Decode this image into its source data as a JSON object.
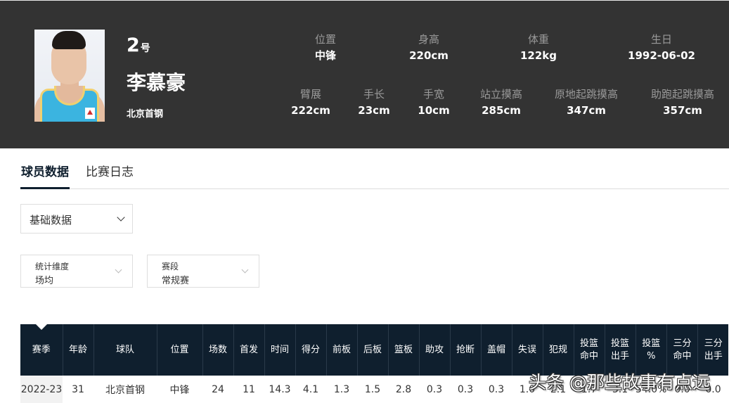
{
  "player": {
    "number": "2",
    "number_suffix": "号",
    "name": "李慕豪",
    "team": "北京首钢"
  },
  "attributes_row1": [
    {
      "label": "位置",
      "value": "中锋"
    },
    {
      "label": "身高",
      "value": "220cm"
    },
    {
      "label": "体重",
      "value": "122kg"
    },
    {
      "label": "生日",
      "value": "1992-06-02"
    }
  ],
  "attributes_row2": [
    {
      "label": "臂展",
      "value": "222cm"
    },
    {
      "label": "手长",
      "value": "23cm"
    },
    {
      "label": "手宽",
      "value": "10cm"
    },
    {
      "label": "站立摸高",
      "value": "285cm"
    },
    {
      "label": "原地起跳摸高",
      "value": "347cm"
    },
    {
      "label": "助跑起跳摸高",
      "value": "357cm"
    }
  ],
  "tabs": [
    {
      "label": "球员数据",
      "active": true
    },
    {
      "label": "比赛日志",
      "active": false
    }
  ],
  "data_type_select": {
    "value": "基础数据"
  },
  "filters": [
    {
      "label": "统计维度",
      "value": "场均"
    },
    {
      "label": "赛段",
      "value": "常规赛"
    }
  ],
  "table": {
    "headers": [
      "赛季",
      "年龄",
      "球队",
      "位置",
      "场数",
      "首发",
      "时间",
      "得分",
      "前板",
      "后板",
      "篮板",
      "助攻",
      "抢断",
      "盖帽",
      "失误",
      "犯规",
      "投篮命中",
      "投篮出手",
      "投篮%",
      "三分命中",
      "三分出手"
    ],
    "header_lines": [
      [
        "赛季"
      ],
      [
        "年龄"
      ],
      [
        "球队"
      ],
      [
        "位置"
      ],
      [
        "场数"
      ],
      [
        "首发"
      ],
      [
        "时间"
      ],
      [
        "得分"
      ],
      [
        "前板"
      ],
      [
        "后板"
      ],
      [
        "篮板"
      ],
      [
        "助攻"
      ],
      [
        "抢断"
      ],
      [
        "盖帽"
      ],
      [
        "失误"
      ],
      [
        "犯规"
      ],
      [
        "投篮",
        "命中"
      ],
      [
        "投篮",
        "出手"
      ],
      [
        "投篮",
        "%"
      ],
      [
        "三分",
        "命中"
      ],
      [
        "三分",
        "出手"
      ]
    ],
    "rows": [
      [
        "2022-23",
        "31",
        "北京首钢",
        "中锋",
        "24",
        "11",
        "14.3",
        "4.1",
        "1.3",
        "1.5",
        "2.8",
        "0.3",
        "0.3",
        "0.3",
        "1.0",
        "2.1",
        "1.7",
        "3.1",
        "54.0%",
        "0.0",
        "0.0"
      ]
    ]
  },
  "watermark": "头条 @那些故事有点远"
}
